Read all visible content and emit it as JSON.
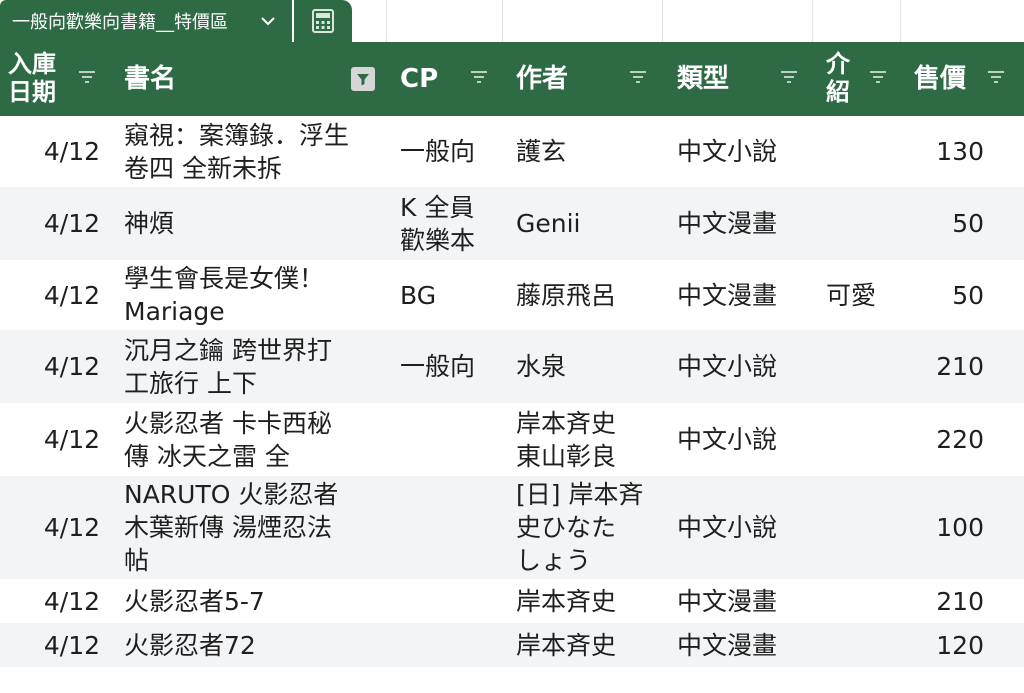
{
  "sheet_tab": {
    "name": "一般向歡樂向書籍__特價區",
    "icon": "chevron-down-icon"
  },
  "calc_tab": {
    "icon": "calculator-icon"
  },
  "columns": [
    {
      "key": "date",
      "label": "入庫\n日期",
      "filter_icon": "filter-icon"
    },
    {
      "key": "title",
      "label": "書名",
      "filter_icon": "filter-active-icon"
    },
    {
      "key": "cp",
      "label": "CP",
      "filter_icon": "filter-icon"
    },
    {
      "key": "author",
      "label": "作者",
      "filter_icon": "filter-icon"
    },
    {
      "key": "type",
      "label": "類型",
      "filter_icon": "filter-icon"
    },
    {
      "key": "intro",
      "label": "介\n紹",
      "filter_icon": "filter-icon"
    },
    {
      "key": "price",
      "label": "售價",
      "filter_icon": "filter-icon"
    }
  ],
  "rows": [
    {
      "date": "4/12",
      "title": "窺視：案簿錄．浮生\n卷四 全新未拆",
      "cp": "一般向",
      "author": "護玄",
      "type": "中文小說",
      "intro": "",
      "price": "130"
    },
    {
      "date": "4/12",
      "title": "神煩",
      "cp": "K 全員\n歡樂本",
      "author": "Genii",
      "type": "中文漫畫",
      "intro": "",
      "price": "50"
    },
    {
      "date": "4/12",
      "title": "學生會長是女僕！\nMariage",
      "cp": "BG",
      "author": "藤原飛呂",
      "type": "中文漫畫",
      "intro": "可愛",
      "price": "50"
    },
    {
      "date": "4/12",
      "title": "沉月之鑰 跨世界打\n工旅行 上下",
      "cp": "一般向",
      "author": "水泉",
      "type": "中文小說",
      "intro": "",
      "price": "210"
    },
    {
      "date": "4/12",
      "title": "火影忍者 卡卡西秘\n傳 冰天之雷 全",
      "cp": "",
      "author": "岸本斉史\n東山彰良",
      "type": "中文小說",
      "intro": "",
      "price": "220"
    },
    {
      "date": "4/12",
      "title": "NARUTO 火影忍者\n木葉新傳 湯煙忍法\n帖",
      "cp": "",
      "author": "[日] 岸本斉\n史ひなた\nしょう",
      "type": "中文小說",
      "intro": "",
      "price": "100"
    },
    {
      "date": "4/12",
      "title": "火影忍者5-7",
      "cp": "",
      "author": "岸本斉史",
      "type": "中文漫畫",
      "intro": "",
      "price": "210"
    },
    {
      "date": "4/12",
      "title": "火影忍者72",
      "cp": "",
      "author": "岸本斉史",
      "type": "中文漫畫",
      "intro": "",
      "price": "120"
    }
  ],
  "colors": {
    "header_bg": "#2e6b45",
    "header_text": "#ffffff",
    "alt_row": "#f2f4f6"
  }
}
